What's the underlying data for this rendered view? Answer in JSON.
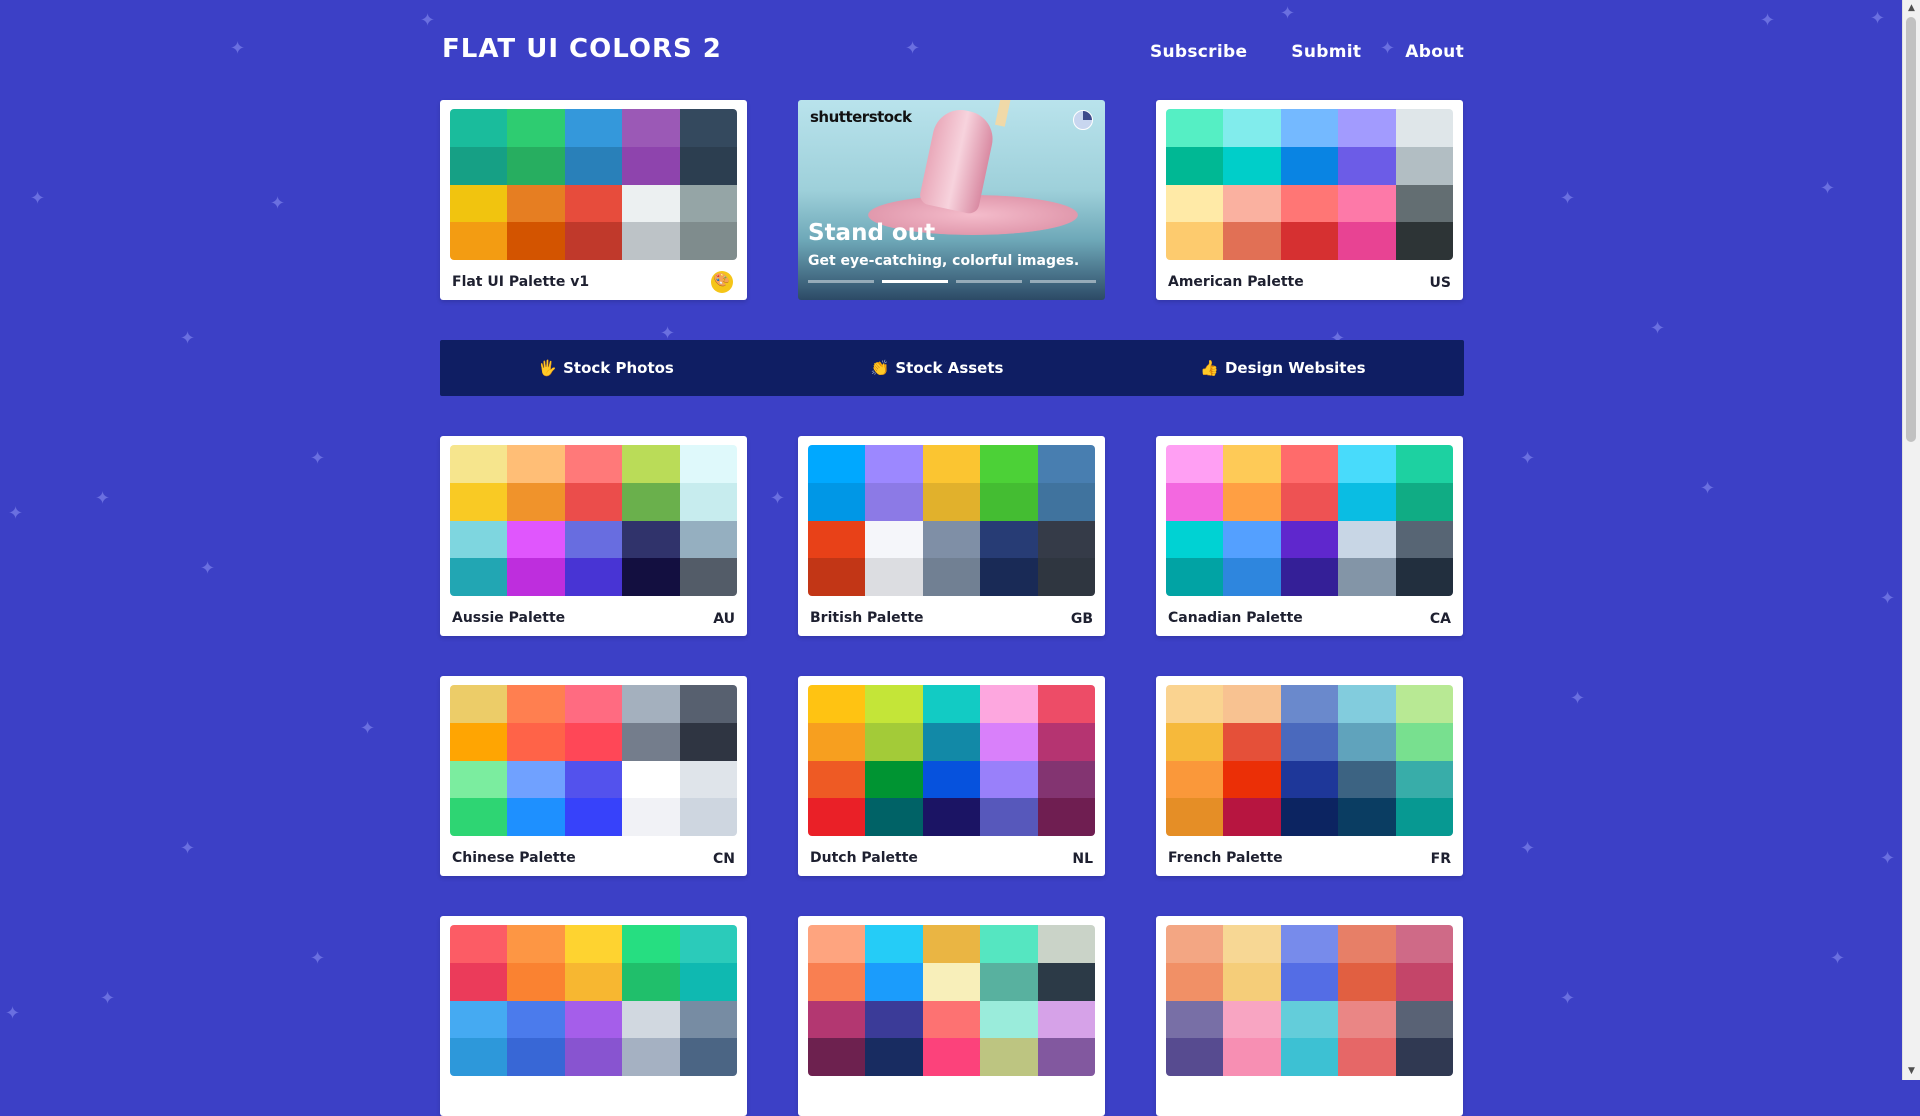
{
  "logo": "FLAT UI COLORS 2",
  "nav": {
    "subscribe": "Subscribe",
    "submit": "Submit",
    "about": "About"
  },
  "ad": {
    "brand": "shutterstock",
    "title": "Stand out",
    "subtitle": "Get eye-catching, colorful images.",
    "slides": 4,
    "active_slide": 2
  },
  "promo": [
    {
      "emoji": "🖐",
      "label": "Stock Photos"
    },
    {
      "emoji": "👏",
      "label": "Stock Assets"
    },
    {
      "emoji": "👍",
      "label": "Design Websites"
    }
  ],
  "palettes": [
    {
      "name": "Flat UI Palette v1",
      "code": "",
      "emoji": "🎨",
      "colors": [
        "#1abc9c",
        "#2ecc71",
        "#3498db",
        "#9b59b6",
        "#34495e",
        "#16a085",
        "#27ae60",
        "#2980b9",
        "#8e44ad",
        "#2c3e50",
        "#f1c40f",
        "#e67e22",
        "#e74c3c",
        "#ecf0f1",
        "#95a5a6",
        "#f39c12",
        "#d35400",
        "#c0392b",
        "#bdc3c7",
        "#7f8c8d"
      ]
    },
    {
      "name": "American Palette",
      "code": "US",
      "colors": [
        "#55efc4",
        "#81ecec",
        "#74b9ff",
        "#a29bfe",
        "#dfe6e9",
        "#00b894",
        "#00cec9",
        "#0984e3",
        "#6c5ce7",
        "#b2bec3",
        "#ffeaa7",
        "#fab1a0",
        "#ff7675",
        "#fd79a8",
        "#636e72",
        "#fdcb6e",
        "#e17055",
        "#d63031",
        "#e84393",
        "#2d3436"
      ]
    },
    {
      "name": "Aussie Palette",
      "code": "AU",
      "colors": [
        "#f6e58d",
        "#ffbe76",
        "#ff7979",
        "#badc58",
        "#dff9fb",
        "#f9ca24",
        "#f0932b",
        "#eb4d4b",
        "#6ab04c",
        "#c7ecee",
        "#7ed6df",
        "#e056fd",
        "#686de0",
        "#30336b",
        "#95afc0",
        "#22a6b3",
        "#be2edd",
        "#4834d4",
        "#130f40",
        "#535c68"
      ]
    },
    {
      "name": "British Palette",
      "code": "GB",
      "colors": [
        "#00a8ff",
        "#9c88ff",
        "#fbc531",
        "#4cd137",
        "#487eb0",
        "#0097e6",
        "#8c7ae6",
        "#e1b12c",
        "#44bd32",
        "#40739e",
        "#e84118",
        "#f5f6fa",
        "#7f8fa6",
        "#273c75",
        "#353b48",
        "#c23616",
        "#dcdde1",
        "#718093",
        "#192a56",
        "#2f3640"
      ]
    },
    {
      "name": "Canadian Palette",
      "code": "CA",
      "colors": [
        "#ff9ff3",
        "#feca57",
        "#ff6b6b",
        "#48dbfb",
        "#1dd1a1",
        "#f368e0",
        "#ff9f43",
        "#ee5253",
        "#0abde3",
        "#10ac84",
        "#00d2d3",
        "#54a0ff",
        "#5f27cd",
        "#c8d6e5",
        "#576574",
        "#01a3a4",
        "#2e86de",
        "#341f97",
        "#8395a7",
        "#222f3e"
      ]
    },
    {
      "name": "Chinese Palette",
      "code": "CN",
      "colors": [
        "#eccc68",
        "#ff7f50",
        "#ff6b81",
        "#a4b0be",
        "#57606f",
        "#ffa502",
        "#ff6348",
        "#ff4757",
        "#747d8c",
        "#2f3542",
        "#7bed9f",
        "#70a1ff",
        "#5352ed",
        "#ffffff",
        "#dfe4ea",
        "#2ed573",
        "#1e90ff",
        "#3742fa",
        "#f1f2f6",
        "#ced6e0"
      ]
    },
    {
      "name": "Dutch Palette",
      "code": "NL",
      "colors": [
        "#ffc312",
        "#c4e538",
        "#12cbc4",
        "#fda7df",
        "#ed4c67",
        "#f79f1f",
        "#a3cb38",
        "#1289a7",
        "#d980fa",
        "#b53471",
        "#ee5a24",
        "#009432",
        "#0652dd",
        "#9980fa",
        "#833471",
        "#ea2027",
        "#006266",
        "#1b1464",
        "#5758bb",
        "#6f1e51"
      ]
    },
    {
      "name": "French Palette",
      "code": "FR",
      "colors": [
        "#fad390",
        "#f8c291",
        "#6a89cc",
        "#82ccdd",
        "#b8e994",
        "#f6b93b",
        "#e55039",
        "#4a69bd",
        "#60a3bc",
        "#78e08f",
        "#fa983a",
        "#eb2f06",
        "#1e3799",
        "#3c6382",
        "#38ada9",
        "#e58e26",
        "#b71540",
        "#0c2461",
        "#0a3d62",
        "#079992"
      ]
    },
    {
      "name": "",
      "code": "",
      "colors": [
        "#fc5c65",
        "#fd9644",
        "#fed330",
        "#26de81",
        "#2bcbba",
        "#eb3b5a",
        "#fa8231",
        "#f7b731",
        "#20bf6b",
        "#0fb9b1",
        "#45aaf2",
        "#4b7bec",
        "#a55eea",
        "#d1d8e0",
        "#778ca3",
        "#2d98da",
        "#3867d6",
        "#8854d0",
        "#a5b1c2",
        "#4b6584"
      ]
    },
    {
      "name": "",
      "code": "",
      "colors": [
        "#fea47f",
        "#25ccf7",
        "#eab543",
        "#55e6c1",
        "#cad3c8",
        "#f97f51",
        "#1b9cfc",
        "#f8efba",
        "#58b19f",
        "#2c3a47",
        "#b33771",
        "#3b3b98",
        "#fd7272",
        "#9aecdb",
        "#d6a2e8",
        "#6d214f",
        "#182c61",
        "#fc427b",
        "#bdc581",
        "#82589f"
      ]
    },
    {
      "name": "",
      "code": "",
      "colors": [
        "#f3a683",
        "#f7d794",
        "#778beb",
        "#e77f67",
        "#cf6a87",
        "#f19066",
        "#f5cd79",
        "#546de5",
        "#e15f41",
        "#c44569",
        "#786fa6",
        "#f8a5c2",
        "#63cdda",
        "#ea8685",
        "#596275",
        "#574b90",
        "#f78fb3",
        "#3dc1d3",
        "#e66767",
        "#303952"
      ]
    }
  ]
}
